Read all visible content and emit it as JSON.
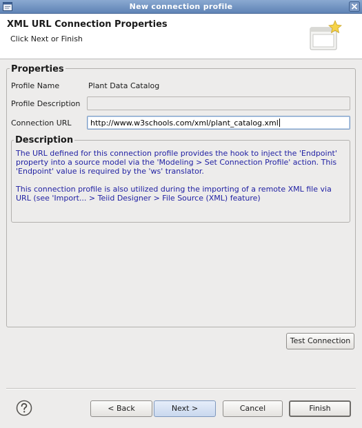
{
  "window": {
    "title": "New connection profile"
  },
  "header": {
    "title": "XML URL Connection Properties",
    "subtitle": "Click Next or Finish"
  },
  "properties": {
    "legend": "Properties",
    "profile_name_label": "Profile Name",
    "profile_name_value": "Plant Data Catalog",
    "profile_description_label": "Profile Description",
    "profile_description_value": "",
    "connection_url_label": "Connection URL",
    "connection_url_value": "http://www.w3schools.com/xml/plant_catalog.xml"
  },
  "description": {
    "legend": "Description",
    "paragraph1": "The URL defined for this connection profile provides the hook to inject the 'Endpoint' property into a source model via the 'Modeling > Set Connection Profile' action.  This 'Endpoint' value is required by the 'ws' translator.",
    "paragraph2": "This connection profile is also utilized during the importing of a remote XML file via URL (see 'Import... > Teiid Designer > File Source (XML) feature)"
  },
  "buttons": {
    "test_connection": "Test Connection",
    "back": "< Back",
    "next": "Next >",
    "cancel": "Cancel",
    "finish": "Finish"
  },
  "icons": {
    "window": "eclipse-window-icon",
    "close": "close-icon",
    "banner": "connection-wizard-banner-icon",
    "help": "help-icon"
  },
  "colors": {
    "titlebar": "#6f92c2",
    "description_text": "#1e1ea2",
    "dialog_background": "#edeceb"
  }
}
